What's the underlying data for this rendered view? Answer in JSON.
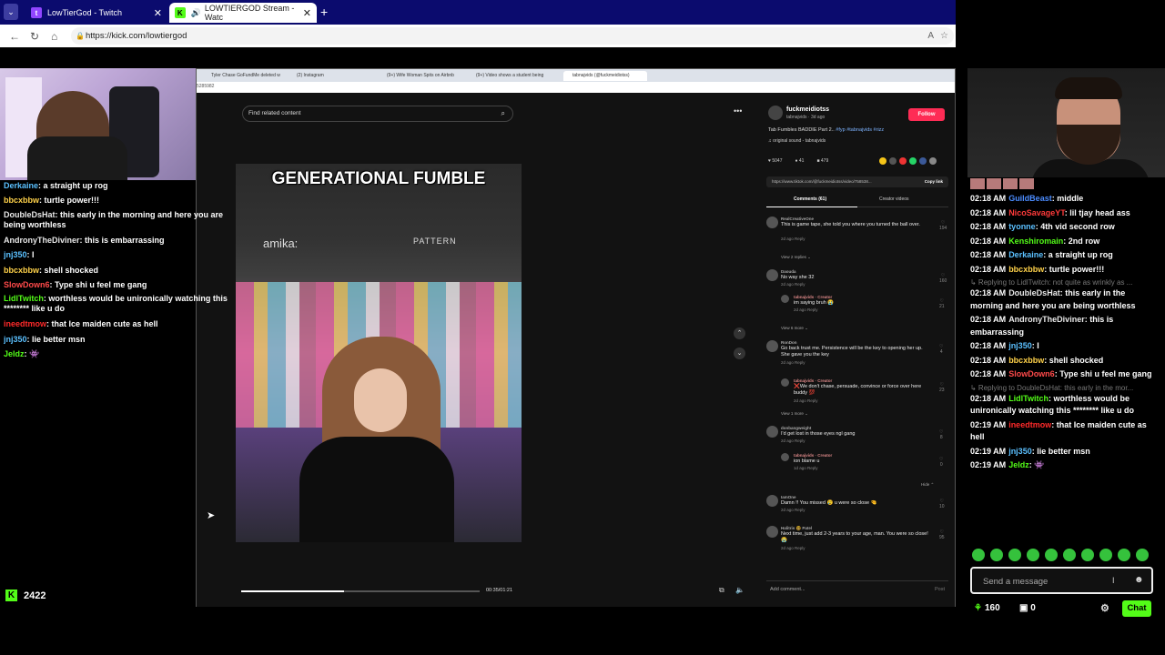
{
  "browser": {
    "tabs": [
      {
        "label": "LowTierGod - Twitch",
        "icon": "twitch-icon",
        "color": "#9146ff"
      },
      {
        "label": "LOWTIERGOD Stream - Watc",
        "icon": "kick-icon",
        "color": "#53fc18"
      }
    ],
    "url": "https://kick.com/lowtiergod"
  },
  "inner_browser": {
    "tabs": [
      "Tyler Chase GoFundMe deleted w",
      "(2) Instagram",
      "(9+) Wife Woman Spits on Airbnb",
      "(9+) Video shows a student being",
      "tabnajvids (@fuckmeidiotss)"
    ],
    "address": "5285982"
  },
  "tiktok": {
    "search_placeholder": "Find related content",
    "video_caption": "GENERATIONAL FUMBLE",
    "sign_left": "amika:",
    "sign_right": "PATTERN",
    "time": "00:35/01:21",
    "progress": 0.43,
    "account_name": "fuckmeidiotss",
    "account_sub": "tabnajvids · 3d ago",
    "follow_label": "Follow",
    "description": "Tab Fumbles BADDIE Part 2..",
    "hashtags": "#fyp #tabnajvids #rizz",
    "sound": "♫ original sound - tabnajvids",
    "stats": [
      "♥ 5047",
      "● 41",
      "■ 479"
    ],
    "link": "https://www.tiktok.com/@fuckmeidiotss/video/758538...",
    "copy_link": "Copy link",
    "tab_comments": "Comments (61)",
    "tab_creator": "Creator videos",
    "comments": [
      {
        "name": "RealCreativeOne",
        "text": "This is game tape, she told you where you turned the ball over.",
        "meta": "2d ago   Reply",
        "likes": "194"
      },
      {
        "name": "View 2 replies ⌄",
        "text": "",
        "meta": "",
        "likes": ""
      },
      {
        "name": "Daouda",
        "text": "No way she 32",
        "meta": "2d ago   Reply",
        "likes": "160"
      },
      {
        "name": "tabnajvids · Creator",
        "text": "im saying bruh 😭",
        "meta": "2d ago   Reply",
        "likes": "21"
      },
      {
        "name": "View 6 more ⌄",
        "text": "",
        "meta": "",
        "likes": ""
      },
      {
        "name": "RonDon",
        "text": "Go back trust me. Persistence will be the key to opening her up. She gave you the key",
        "meta": "2d ago   Reply",
        "likes": "4"
      },
      {
        "name": "tabnajvids · Creator",
        "text": "❌We don't chase, persuade, convince or force over here buddy 💯",
        "meta": "2d ago   Reply",
        "likes": "23"
      },
      {
        "name": "View 1 more ⌄",
        "text": "",
        "meta": "",
        "likes": ""
      },
      {
        "name": "donbangweight",
        "text": "I'd get lost in those eyes ngl gang",
        "meta": "2d ago   Reply",
        "likes": "8"
      },
      {
        "name": "tabnajvids · Creator",
        "text": "ion blame u",
        "meta": "1d ago   Reply",
        "likes": "0"
      },
      {
        "name": "Hide ⌃",
        "text": "",
        "meta": "",
        "likes": ""
      },
      {
        "name": "IamOne",
        "text": "Damn !! You missed 😢 u were so close 🤏",
        "meta": "2d ago   Reply",
        "likes": "10"
      },
      {
        "name": "Halitris 🤓 Patel",
        "text": "Next time, just add 2-3 years to your age, man. You were so close! 😭",
        "meta": "2d ago   Reply",
        "likes": "95"
      }
    ],
    "add_comment": "Add comment...",
    "post": "Post"
  },
  "overlay_chat": [
    {
      "user": "Derkaine",
      "color": "#5bc0ff",
      "text": "a straight up rog",
      "wrap": false
    },
    {
      "user": "bbcxbbw",
      "color": "#ffd24a",
      "text": "turtle power!!!",
      "wrap": false
    },
    {
      "user": "DoubleDsHat",
      "color": "#e8e8e8",
      "text": "this early in the morning and here you are being worthless",
      "wrap": true
    },
    {
      "user": "AndronyTheDiviner",
      "color": "#e8e8e8",
      "text": "this is embarrassing",
      "wrap": false
    },
    {
      "user": "jnj350",
      "color": "#5bc0ff",
      "text": "I",
      "wrap": false
    },
    {
      "user": "bbcxbbw",
      "color": "#ffd24a",
      "text": "shell shocked",
      "wrap": false
    },
    {
      "user": "SlowDown6",
      "color": "#ff4a4a",
      "text": "Type shi u feel me gang",
      "wrap": false
    },
    {
      "user": "LidlTwitch",
      "color": "#53fc18",
      "text": "worthless would be unironically watching this ******** like u do",
      "wrap": true
    },
    {
      "user": "ineedtmow",
      "color": "#ff2a2a",
      "text": "that Ice maiden cute as hell",
      "wrap": false
    },
    {
      "user": "jnj350",
      "color": "#5bc0ff",
      "text": "lie better msn",
      "wrap": false
    },
    {
      "user": "Jeldz",
      "color": "#53fc18",
      "text": "👾",
      "wrap": false
    }
  ],
  "viewer_count": "2422",
  "right_chat": [
    {
      "time": "02:18 AM",
      "user": "GuildBeast",
      "color": "#4b8cff",
      "text": "middle"
    },
    {
      "time": "02:18 AM",
      "user": "NicoSavageYT",
      "color": "#ff3a3a",
      "text": "lil tjay head ass"
    },
    {
      "time": "02:18 AM",
      "user": "tyonne",
      "color": "#5bc0ff",
      "text": "4th vid second row"
    },
    {
      "time": "02:18 AM",
      "user": "Kenshiromain",
      "color": "#53fc18",
      "text": "2nd row"
    },
    {
      "time": "02:18 AM",
      "user": "Derkaine",
      "color": "#5bc0ff",
      "text": "a straight up rog"
    },
    {
      "time": "02:18 AM",
      "user": "bbcxbbw",
      "color": "#ffd24a",
      "text": "turtle power!!!"
    },
    {
      "reply": "↳ Replying to LidlTwitch: not quite as wrinkly as ..."
    },
    {
      "time": "02:18 AM",
      "user": "DoubleDsHat",
      "color": "#e8e8e8",
      "text": "this early in the morning and here you are being worthless"
    },
    {
      "time": "02:18 AM",
      "user": "AndronyTheDiviner",
      "color": "#e8e8e8",
      "text": "this is embarrassing"
    },
    {
      "time": "02:18 AM",
      "user": "jnj350",
      "color": "#5bc0ff",
      "text": "I"
    },
    {
      "time": "02:18 AM",
      "user": "bbcxbbw",
      "color": "#ffd24a",
      "text": "shell shocked"
    },
    {
      "time": "02:18 AM",
      "user": "SlowDown6",
      "color": "#ff4a4a",
      "text": "Type shi u feel me gang"
    },
    {
      "reply": "↳ Replying to DoubleDsHat: this early in the mor..."
    },
    {
      "time": "02:18 AM",
      "user": "LidlTwitch",
      "color": "#53fc18",
      "text": "worthless would be unironically watching this ******** like u do"
    },
    {
      "time": "02:19 AM",
      "user": "ineedtmow",
      "color": "#ff2a2a",
      "text": "that Ice maiden cute as hell"
    },
    {
      "time": "02:19 AM",
      "user": "jnj350",
      "color": "#5bc0ff",
      "text": "lie better msn"
    },
    {
      "time": "02:19 AM",
      "user": "Jeldz",
      "color": "#53fc18",
      "text": "👾"
    }
  ],
  "chat_input_placeholder": "Send a message",
  "points": "160",
  "store_count": "0",
  "chat_button": "Chat"
}
